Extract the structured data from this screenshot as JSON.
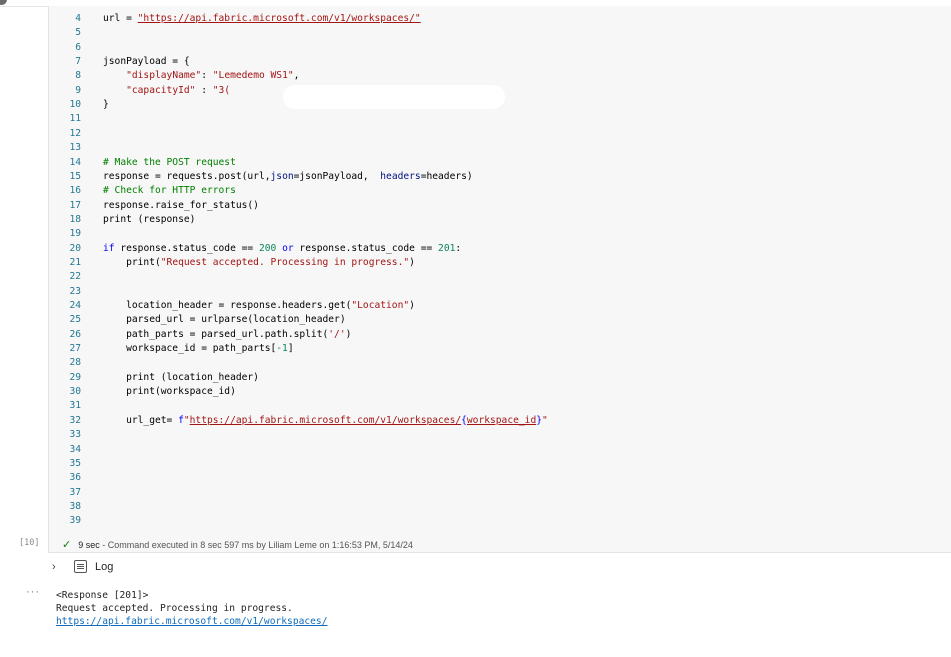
{
  "cell": {
    "execution_count": "[10]",
    "code_lines": [
      {
        "n": "4",
        "tokens": [
          {
            "t": "url = ",
            "c": ""
          },
          {
            "t": "\"https://api.fabric.microsoft.com/v1/workspaces/\"",
            "c": "url"
          }
        ]
      },
      {
        "n": "5",
        "tokens": []
      },
      {
        "n": "6",
        "tokens": []
      },
      {
        "n": "7",
        "tokens": [
          {
            "t": "jsonPayload = {",
            "c": ""
          }
        ]
      },
      {
        "n": "8",
        "tokens": [
          {
            "t": "    ",
            "c": ""
          },
          {
            "t": "\"displayName\"",
            "c": "str"
          },
          {
            "t": ": ",
            "c": ""
          },
          {
            "t": "\"Lemedemo WS1\"",
            "c": "str"
          },
          {
            "t": ",",
            "c": ""
          }
        ]
      },
      {
        "n": "9",
        "tokens": [
          {
            "t": "    ",
            "c": ""
          },
          {
            "t": "\"capacityId\"",
            "c": "str"
          },
          {
            "t": " : ",
            "c": ""
          },
          {
            "t": "\"3(",
            "c": "str"
          }
        ]
      },
      {
        "n": "10",
        "tokens": [
          {
            "t": "}",
            "c": ""
          }
        ]
      },
      {
        "n": "11",
        "tokens": []
      },
      {
        "n": "12",
        "tokens": []
      },
      {
        "n": "13",
        "tokens": []
      },
      {
        "n": "14",
        "tokens": [
          {
            "t": "# Make the POST request",
            "c": "cmt"
          }
        ]
      },
      {
        "n": "15",
        "tokens": [
          {
            "t": "response = requests.post(url,",
            "c": ""
          },
          {
            "t": "json",
            "c": "param"
          },
          {
            "t": "=jsonPayload,  ",
            "c": ""
          },
          {
            "t": "headers",
            "c": "param"
          },
          {
            "t": "=headers)",
            "c": ""
          }
        ]
      },
      {
        "n": "16",
        "tokens": [
          {
            "t": "# Check for HTTP errors",
            "c": "cmt"
          }
        ]
      },
      {
        "n": "17",
        "tokens": [
          {
            "t": "response.raise_for_status()",
            "c": ""
          }
        ]
      },
      {
        "n": "18",
        "tokens": [
          {
            "t": "print (response)",
            "c": ""
          }
        ]
      },
      {
        "n": "19",
        "tokens": []
      },
      {
        "n": "20",
        "tokens": [
          {
            "t": "if",
            "c": "kw"
          },
          {
            "t": " response.status_code == ",
            "c": ""
          },
          {
            "t": "200",
            "c": "num"
          },
          {
            "t": " ",
            "c": ""
          },
          {
            "t": "or",
            "c": "kw"
          },
          {
            "t": " response.status_code == ",
            "c": ""
          },
          {
            "t": "201",
            "c": "num"
          },
          {
            "t": ":",
            "c": ""
          }
        ]
      },
      {
        "n": "21",
        "tokens": [
          {
            "t": "    print(",
            "c": ""
          },
          {
            "t": "\"Request accepted. Processing in progress.\"",
            "c": "str"
          },
          {
            "t": ")",
            "c": ""
          }
        ]
      },
      {
        "n": "22",
        "tokens": []
      },
      {
        "n": "23",
        "tokens": []
      },
      {
        "n": "24",
        "tokens": [
          {
            "t": "    location_header = response.headers.get(",
            "c": ""
          },
          {
            "t": "\"Location\"",
            "c": "str"
          },
          {
            "t": ")",
            "c": ""
          }
        ]
      },
      {
        "n": "25",
        "tokens": [
          {
            "t": "    parsed_url = urlparse(location_header)",
            "c": ""
          }
        ]
      },
      {
        "n": "26",
        "tokens": [
          {
            "t": "    path_parts = parsed_url.path.split(",
            "c": ""
          },
          {
            "t": "'/'",
            "c": "str"
          },
          {
            "t": ")",
            "c": ""
          }
        ]
      },
      {
        "n": "27",
        "tokens": [
          {
            "t": "    workspace_id = path_parts[",
            "c": ""
          },
          {
            "t": "-1",
            "c": "num"
          },
          {
            "t": "]",
            "c": ""
          }
        ]
      },
      {
        "n": "28",
        "tokens": []
      },
      {
        "n": "29",
        "tokens": [
          {
            "t": "    print (location_header)",
            "c": ""
          }
        ]
      },
      {
        "n": "30",
        "tokens": [
          {
            "t": "    print(workspace_id)",
            "c": ""
          }
        ]
      },
      {
        "n": "31",
        "tokens": []
      },
      {
        "n": "32",
        "tokens": [
          {
            "t": "    url_get= ",
            "c": ""
          },
          {
            "t": "f",
            "c": "kw"
          },
          {
            "t": "\"",
            "c": "str"
          },
          {
            "t": "https://api.fabric.microsoft.com/v1/workspaces/",
            "c": "url"
          },
          {
            "t": "{",
            "c": "kw"
          },
          {
            "t": "workspace_id",
            "c": "url"
          },
          {
            "t": "}",
            "c": "kw"
          },
          {
            "t": "\"",
            "c": "str"
          }
        ]
      },
      {
        "n": "33",
        "tokens": []
      },
      {
        "n": "34",
        "tokens": []
      },
      {
        "n": "35",
        "tokens": []
      },
      {
        "n": "36",
        "tokens": []
      },
      {
        "n": "37",
        "tokens": []
      },
      {
        "n": "38",
        "tokens": []
      },
      {
        "n": "39",
        "tokens": []
      }
    ],
    "status": {
      "duration": "9 sec",
      "message": " - Command executed in 8 sec 597 ms by Liliam Leme on 1:16:53 PM, 5/14/24"
    }
  },
  "log": {
    "label": "Log",
    "more": "···"
  },
  "output": {
    "lines": [
      "<Response [201]>",
      "Request accepted. Processing in progress."
    ],
    "url": "https://api.fabric.microsoft.com/v1/workspaces/"
  },
  "colors": {
    "line_number": "#237893",
    "string": "#a31515",
    "keyword": "#0000ff",
    "comment": "#008000",
    "number": "#098658",
    "check": "#107c10",
    "link": "#0f6cbd"
  }
}
